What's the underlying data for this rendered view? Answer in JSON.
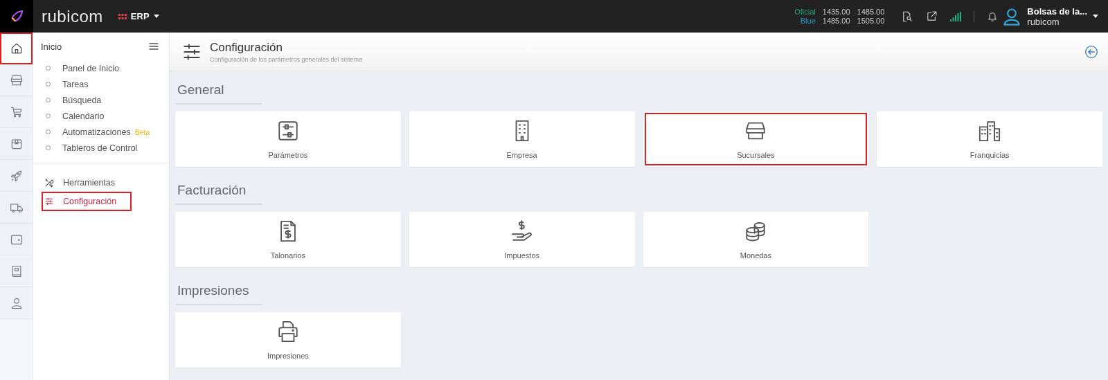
{
  "topbar": {
    "brand": "rubicom",
    "module": "ERP",
    "rates": [
      {
        "name": "Oficial",
        "color": "#1fa47c",
        "buy": "1435.00",
        "sell": "1485.00"
      },
      {
        "name": "Blue",
        "color": "#2b9bd3",
        "buy": "1485.00",
        "sell": "1505.00"
      }
    ],
    "user": {
      "name": "Bolsas de la...",
      "company": "rubicom"
    }
  },
  "rail": [
    {
      "kind": "home",
      "selected": true,
      "highlighted": true
    },
    {
      "kind": "store",
      "selected": false,
      "highlighted": false
    },
    {
      "kind": "cart",
      "selected": false,
      "highlighted": false
    },
    {
      "kind": "box",
      "selected": false,
      "highlighted": false
    },
    {
      "kind": "rocket",
      "selected": false,
      "highlighted": false
    },
    {
      "kind": "truck",
      "selected": false,
      "highlighted": false
    },
    {
      "kind": "wallet",
      "selected": false,
      "highlighted": false
    },
    {
      "kind": "book",
      "selected": false,
      "highlighted": false
    },
    {
      "kind": "user",
      "selected": false,
      "highlighted": false
    }
  ],
  "menu": {
    "title": "Inicio",
    "items": [
      {
        "label": "Panel de Inicio"
      },
      {
        "label": "Tareas"
      },
      {
        "label": "Búsqueda"
      },
      {
        "label": "Calendario"
      },
      {
        "label": "Automatizaciones",
        "badge": "Beta"
      },
      {
        "label": "Tableros de Control"
      }
    ],
    "tools": [
      {
        "kind": "tools",
        "label": "Herramientas",
        "selected": false,
        "highlighted": false
      },
      {
        "kind": "sliders",
        "label": "Configuración",
        "selected": true,
        "highlighted": true
      }
    ]
  },
  "header": {
    "title": "Configuración",
    "subtitle": "Configuración de los parámetros generales del sistema"
  },
  "sections": [
    {
      "title": "General",
      "cards": [
        {
          "kind": "params",
          "label": "Parámetros",
          "highlighted": false
        },
        {
          "kind": "building",
          "label": "Empresa",
          "highlighted": false
        },
        {
          "kind": "store",
          "label": "Sucursales",
          "highlighted": true
        },
        {
          "kind": "buildings",
          "label": "Franquicias",
          "highlighted": false
        }
      ]
    },
    {
      "title": "Facturación",
      "cards": [
        {
          "kind": "invoice",
          "label": "Talonarios",
          "highlighted": false
        },
        {
          "kind": "tax",
          "label": "Impuestos",
          "highlighted": false
        },
        {
          "kind": "coins",
          "label": "Monedas",
          "highlighted": false
        }
      ]
    },
    {
      "title": "Impresiones",
      "cards": [
        {
          "kind": "printer",
          "label": "Impresiones",
          "highlighted": false
        }
      ]
    }
  ]
}
